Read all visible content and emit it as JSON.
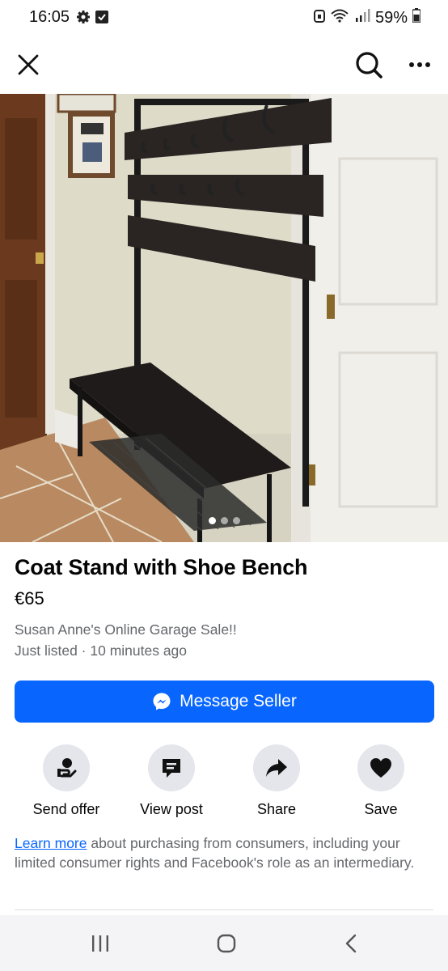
{
  "status_bar": {
    "time": "16:05",
    "battery": "59%",
    "icons": [
      "gear-icon",
      "checkbox-icon",
      "lock-icon",
      "wifi-icon",
      "signal-icon",
      "battery-icon"
    ]
  },
  "app_bar": {
    "icons": [
      "close-icon",
      "search-icon",
      "more-icon"
    ]
  },
  "gallery": {
    "image_count": 3,
    "active_index": 0
  },
  "listing": {
    "title": "Coat Stand with Shoe Bench",
    "price": "€65",
    "seller": "Susan Anne's Online Garage Sale!!",
    "listed": "Just listed · 10 minutes ago"
  },
  "message_button": {
    "label": "Message Seller",
    "icon": "messenger-icon",
    "color": "#0866ff"
  },
  "actions": [
    {
      "label": "Send offer",
      "icon": "send-offer-icon"
    },
    {
      "label": "View post",
      "icon": "view-post-icon"
    },
    {
      "label": "Share",
      "icon": "share-icon"
    },
    {
      "label": "Save",
      "icon": "heart-icon"
    }
  ],
  "disclaimer": {
    "link": "Learn more",
    "text": " about purchasing from consumers, including your limited consumer rights and Facebook's role as an intermediary."
  },
  "nav_bar": {
    "icons": [
      "recents-icon",
      "home-icon",
      "back-icon"
    ]
  }
}
